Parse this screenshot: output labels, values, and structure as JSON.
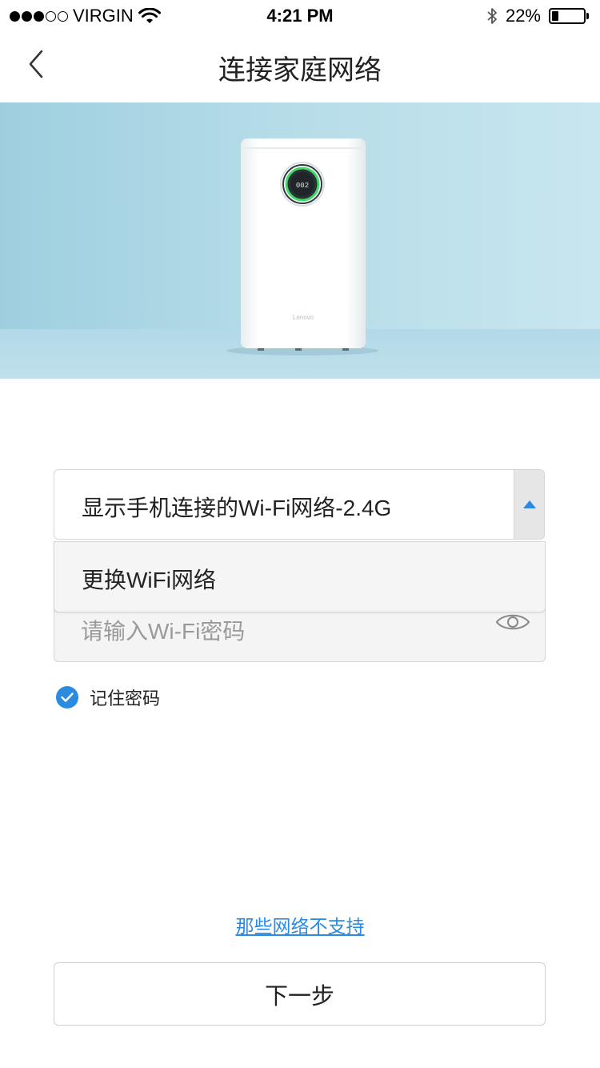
{
  "status_bar": {
    "carrier": "VIRGIN",
    "time": "4:21 PM",
    "battery_percent": "22%",
    "battery_level": 0.22,
    "signal_bars_filled": 3,
    "signal_bars_total": 5,
    "icons": [
      "signal-dots-icon",
      "wifi-icon",
      "bluetooth-icon",
      "battery-icon"
    ]
  },
  "nav": {
    "title": "连接家庭网络",
    "back_icon": "chevron-left-icon"
  },
  "hero": {
    "device_display_text": "002",
    "device_brand": "Lenovo"
  },
  "wifi": {
    "current_network": "显示手机连接的Wi-Fi网络-2.4G",
    "dropdown_option": "更换WiFi网络",
    "password_placeholder": "请输入Wi-Fi密码",
    "remember_password_label": "记住密码",
    "remember_password_checked": true
  },
  "footer": {
    "unsupported_link": "那些网络不支持",
    "next_button": "下一步"
  },
  "colors": {
    "accent": "#2a8be0",
    "hero_background": "#b7dde9"
  }
}
